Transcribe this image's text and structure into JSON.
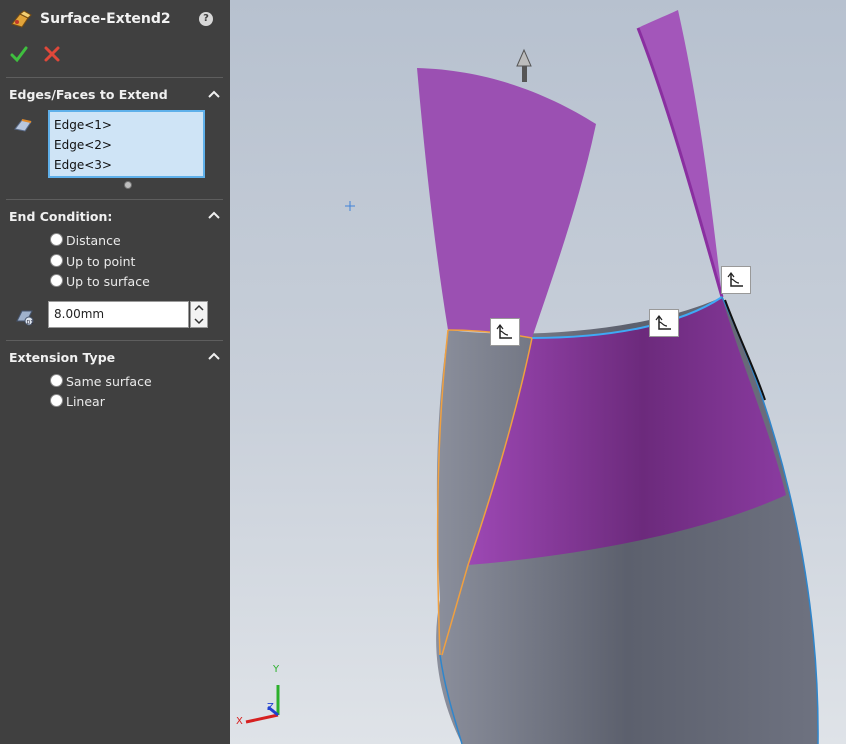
{
  "feature": {
    "title": "Surface-Extend2",
    "help_icon": "help-icon",
    "icon": "surface-extend-icon"
  },
  "actions": {
    "ok_icon": "checkmark-icon",
    "cancel_icon": "close-x-icon"
  },
  "sections": {
    "edges": {
      "title": "Edges/Faces to Extend",
      "items": [
        "Edge<1>",
        "Edge<2>",
        "Edge<3>"
      ]
    },
    "end_condition": {
      "title": "End Condition:",
      "options": [
        "Distance",
        "Up to point",
        "Up to surface"
      ],
      "distance_value": "8.00mm"
    },
    "extension_type": {
      "title": "Extension Type",
      "options": [
        "Same surface",
        "Linear"
      ]
    }
  },
  "viewport": {
    "colors": {
      "extension_face": "#9b4fb3",
      "extension_dark": "#6a2b7c",
      "body_gray": "#6a6f7d",
      "edge_highlight": "#f0a040",
      "selected_edge": "#3fa9f5"
    },
    "triad_labels": {
      "x": "X",
      "y": "Y",
      "z": "Z"
    }
  }
}
